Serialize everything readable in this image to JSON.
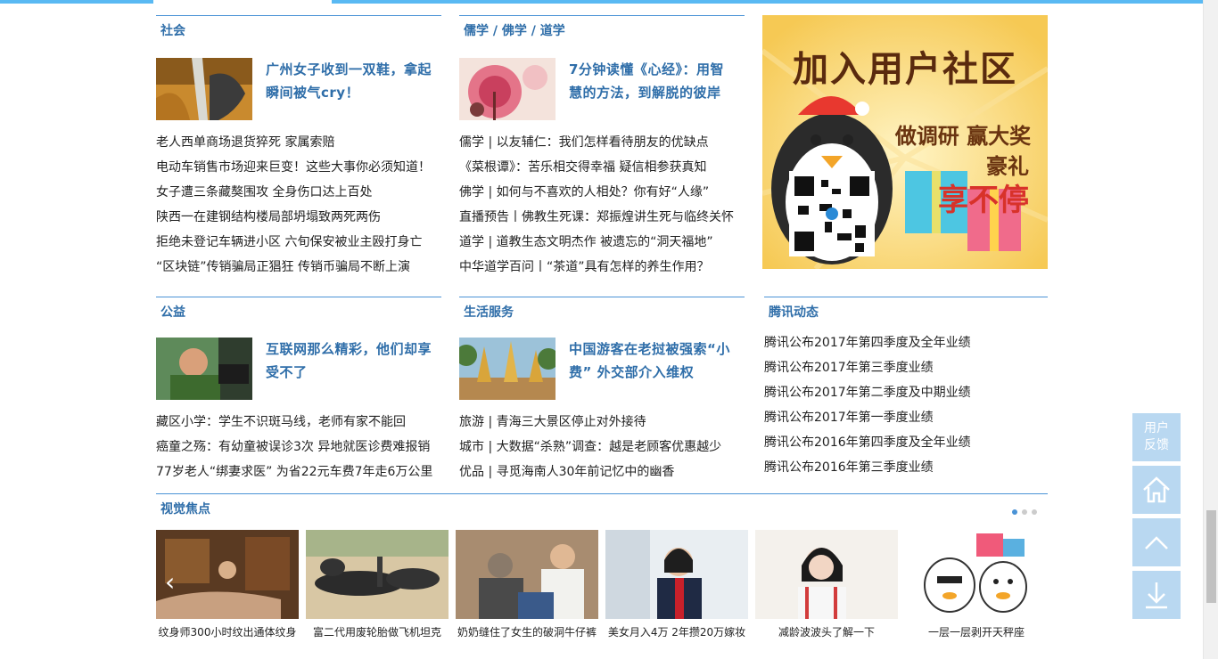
{
  "sections": {
    "society": {
      "title": "社会",
      "feature": "广州女子收到一双鞋，拿起瞬间被气cry！",
      "items": [
        "老人西单商场退货猝死 家属索赔",
        "电动车销售市场迎来巨变！这些大事你必须知道！",
        "女子遭三条藏獒围攻 全身伤口达上百处",
        "陕西一在建钢结构楼局部坍塌致两死两伤",
        "拒绝未登记车辆进小区 六旬保安被业主殴打身亡",
        "“区块链”传销骗局正猖狂 传销币骗局不断上演"
      ]
    },
    "religion": {
      "title": "儒学 / 佛学 / 道学",
      "feature": "7分钟读懂《心经》：用智慧的方法，到解脱的彼岸",
      "items": [
        "儒学 | 以友辅仁：我们怎样看待朋友的优缺点",
        "《菜根谭》：苦乐相交得幸福 疑信相参获真知",
        "佛学 | 如何与不喜欢的人相处？你有好“人缘”",
        "直播预告丨佛教生死课：郑振煌讲生死与临终关怀",
        "道学 | 道教生态文明杰作 被遗忘的“洞天福地”",
        "中华道学百问丨“茶道”具有怎样的养生作用？"
      ]
    },
    "charity": {
      "title": "公益",
      "feature": "互联网那么精彩，他们却享受不了",
      "items": [
        "藏区小学：学生不识斑马线，老师有家不能回",
        "癌童之殇：有幼童被误诊3次 异地就医诊费难报销",
        "77岁老人“绑妻求医” 为省22元车费7年走6万公里"
      ]
    },
    "life": {
      "title": "生活服务",
      "feature": "中国游客在老挝被强索“小费” 外交部介入维权",
      "items": [
        "旅游 | 青海三大景区停止对外接待",
        "城市 | 大数据“杀熟”调查：越是老顾客优惠越少",
        "优品 | 寻觅海南人30年前记忆中的幽香"
      ]
    },
    "tencent": {
      "title": "腾讯动态",
      "items": [
        "腾讯公布2017年第四季度及全年业绩",
        "腾讯公布2017年第三季度业绩",
        "腾讯公布2017年第二季度及中期业绩",
        "腾讯公布2017年第一季度业绩",
        "腾讯公布2016年第四季度及全年业绩",
        "腾讯公布2016年第三季度业绩"
      ]
    }
  },
  "ad": {
    "headline": "加入用户社区",
    "line1": "做调研 赢大奖",
    "line2": "豪礼",
    "line3": "享不停"
  },
  "focus": {
    "title": "视觉焦点",
    "items": [
      "纹身师300小时纹出通体纹身",
      "富二代用废轮胎做飞机坦克",
      "奶奶缝住了女生的破洞牛仔裤",
      "美女月入4万 2年攒20万嫁妆",
      "减龄波波头了解一下",
      "一层一层剥开天秤座"
    ]
  },
  "sidebar": {
    "feedback": [
      "用户",
      "反馈"
    ],
    "home_icon": "home-icon",
    "top_icon": "arrow-up-icon",
    "download_icon": "download-icon"
  },
  "colors": {
    "accent": "#4a93d6",
    "title_blue": "#2f6ea9",
    "topbar": "#59b9f3",
    "side_button": "#b9d8f1"
  }
}
